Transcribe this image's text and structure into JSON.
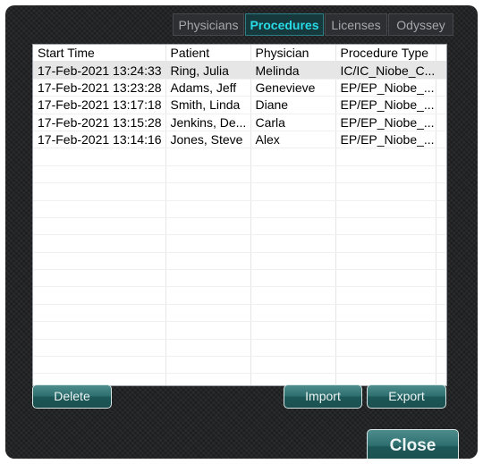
{
  "tabs": [
    {
      "label": "Physicians",
      "active": false
    },
    {
      "label": "Procedures",
      "active": true
    },
    {
      "label": "Licenses",
      "active": false
    },
    {
      "label": "Odyssey",
      "active": false
    }
  ],
  "table": {
    "columns": [
      "Start Time",
      "Patient",
      "Physician",
      "Procedure Type"
    ],
    "rows": [
      {
        "start_time": "17-Feb-2021 13:24:33",
        "patient": "Ring, Julia",
        "physician": "Melinda",
        "procedure_type": "IC/IC_Niobe_C...",
        "selected": true
      },
      {
        "start_time": "17-Feb-2021 13:23:28",
        "patient": "Adams, Jeff",
        "physician": "Genevieve",
        "procedure_type": "EP/EP_Niobe_...",
        "selected": false
      },
      {
        "start_time": "17-Feb-2021 13:17:18",
        "patient": "Smith, Linda",
        "physician": "Diane",
        "procedure_type": "EP/EP_Niobe_...",
        "selected": false
      },
      {
        "start_time": "17-Feb-2021 13:15:28",
        "patient": "Jenkins, De...",
        "physician": "Carla",
        "procedure_type": "EP/EP_Niobe_...",
        "selected": false
      },
      {
        "start_time": "17-Feb-2021 13:14:16",
        "patient": "Jones, Steve",
        "physician": "Alex",
        "procedure_type": "EP/EP_Niobe_...",
        "selected": false
      }
    ]
  },
  "buttons": {
    "delete": "Delete",
    "import": "Import",
    "export": "Export",
    "close": "Close"
  },
  "colors": {
    "active_tab_text": "#28dbe6",
    "button_teal": "#2d6e6e",
    "background": "#1c1d1f"
  }
}
